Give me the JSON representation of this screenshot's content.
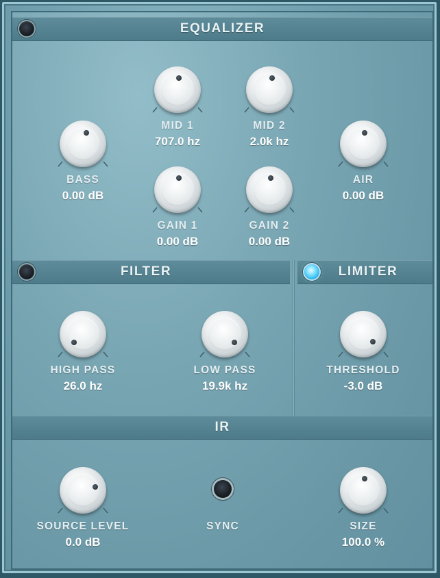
{
  "sections": {
    "equalizer": {
      "title": "EQUALIZER",
      "enabled": false
    },
    "filter": {
      "title": "FILTER",
      "enabled": false
    },
    "limiter": {
      "title": "LIMITER",
      "enabled": true
    },
    "ir": {
      "title": "IR"
    }
  },
  "knobs": {
    "bass": {
      "label": "BASS",
      "value": "0.00 dB"
    },
    "mid1": {
      "label": "MID 1",
      "value": "707.0 hz"
    },
    "mid2": {
      "label": "MID 2",
      "value": "2.0k hz"
    },
    "air": {
      "label": "AIR",
      "value": "0.00 dB"
    },
    "gain1": {
      "label": "GAIN 1",
      "value": "0.00 dB"
    },
    "gain2": {
      "label": "GAIN 2",
      "value": "0.00 dB"
    },
    "high_pass": {
      "label": "HIGH PASS",
      "value": "26.0 hz"
    },
    "low_pass": {
      "label": "LOW PASS",
      "value": "19.9k hz"
    },
    "threshold": {
      "label": "THRESHOLD",
      "value": "-3.0 dB"
    },
    "source_level": {
      "label": "SOURCE LEVEL",
      "value": "0.0 dB"
    },
    "size": {
      "label": "SIZE",
      "value": "100.0 %"
    }
  },
  "sync": {
    "label": "SYNC",
    "enabled": false
  },
  "colors": {
    "panel": "#79a6b3",
    "header_bar": "#557f8d",
    "led_off": "#1b2127",
    "led_on": "#2bb7ee",
    "text": "#e4eff2"
  }
}
